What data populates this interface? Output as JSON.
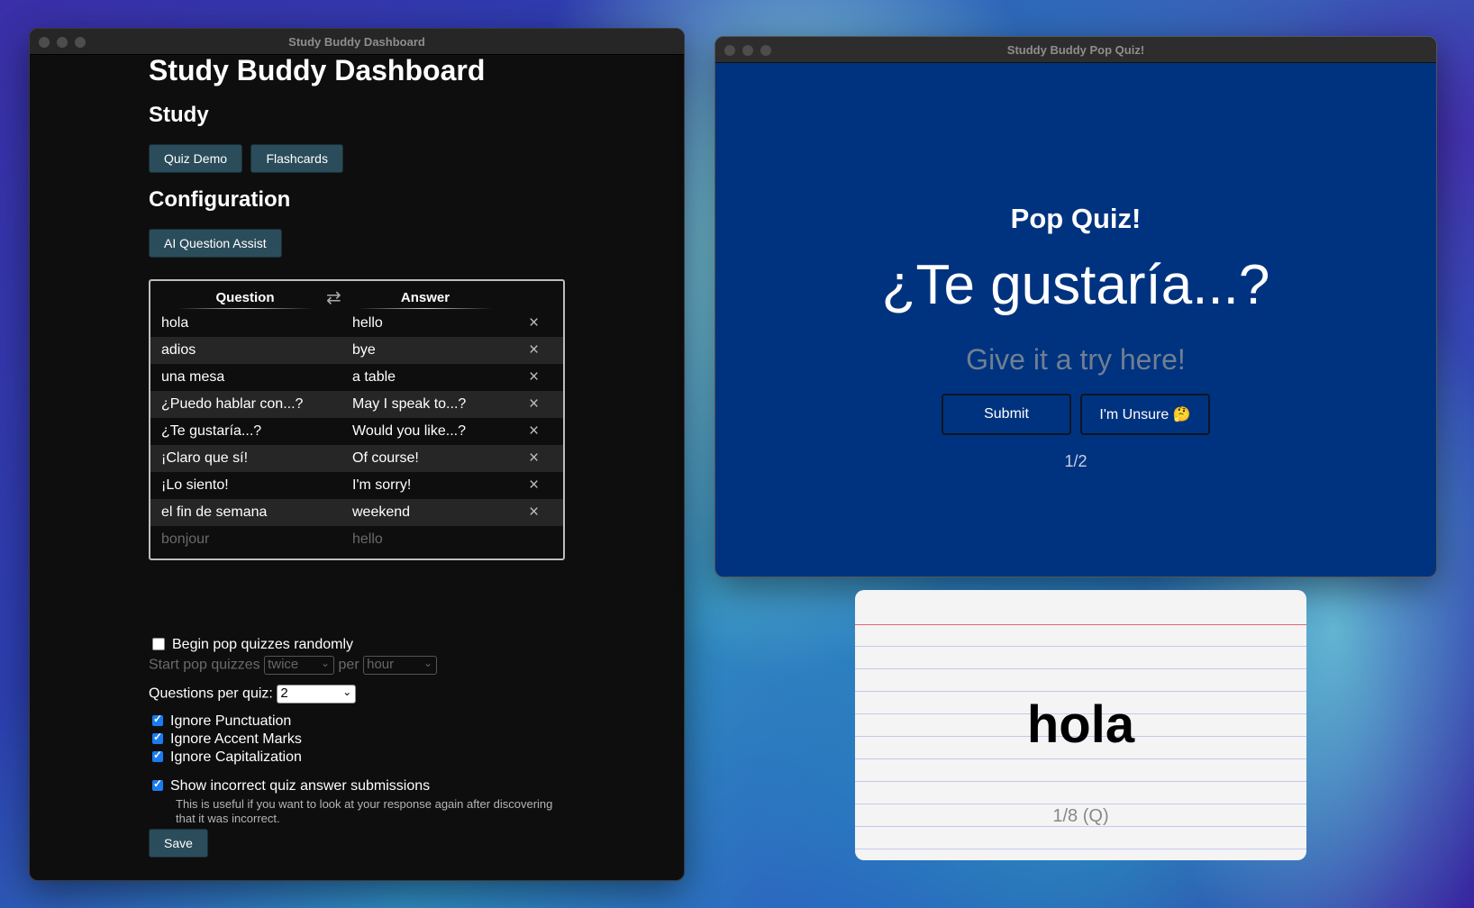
{
  "dashboard": {
    "window_title": "Study Buddy Dashboard",
    "heading": "Study Buddy Dashboard",
    "study_heading": "Study",
    "quiz_demo_label": "Quiz Demo",
    "flashcards_label": "Flashcards",
    "config_heading": "Configuration",
    "ai_assist_label": "AI Question Assist",
    "table": {
      "question_header": "Question",
      "answer_header": "Answer",
      "swap_icon": "swap-arrows-icon",
      "delete_icon": "×",
      "rows": [
        {
          "q": "hola",
          "a": "hello"
        },
        {
          "q": "adios",
          "a": "bye"
        },
        {
          "q": "una mesa",
          "a": "a table"
        },
        {
          "q": "¿Puedo hablar con...?",
          "a": "May I speak to...?"
        },
        {
          "q": "¿Te gustaría...?",
          "a": "Would you like...?"
        },
        {
          "q": "¡Claro que sí!",
          "a": "Of course!"
        },
        {
          "q": "¡Lo siento!",
          "a": "I'm sorry!"
        },
        {
          "q": "el fin de semana",
          "a": "weekend"
        }
      ],
      "new_question_placeholder": "bonjour",
      "new_answer_placeholder": "hello"
    },
    "random_label": "Begin pop quizzes randomly",
    "start_label": "Start pop quizzes",
    "frequency_value": "twice",
    "per_label": "per",
    "period_value": "hour",
    "qpq_label": "Questions per quiz:",
    "qpq_value": "2",
    "ignore_punct": "Ignore Punctuation",
    "ignore_accent": "Ignore Accent Marks",
    "ignore_caps": "Ignore Capitalization",
    "show_incorrect": "Show incorrect quiz answer submissions",
    "show_incorrect_help": "This is useful if you want to look at your response again after discovering that it was incorrect.",
    "save_label": "Save"
  },
  "quiz": {
    "window_title": "Studdy Buddy Pop Quiz!",
    "heading": "Pop Quiz!",
    "prompt": "¿Te gustaría...?",
    "input_placeholder": "Give it a try here!",
    "submit_label": "Submit",
    "unsure_label": "I'm Unsure 🤔",
    "progress": "1/2"
  },
  "flashcard": {
    "word": "hola",
    "counter": "1/8 (Q)"
  }
}
